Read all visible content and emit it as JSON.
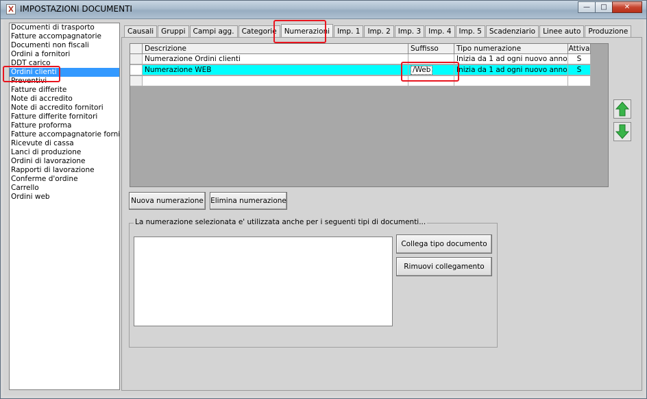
{
  "window": {
    "title": "IMPOSTAZIONI DOCUMENTI",
    "minimize_icon": "minimize-icon",
    "maximize_icon": "maximize-icon",
    "close_icon": "close-icon"
  },
  "doclist": {
    "items": [
      "Documenti di trasporto",
      "Fatture accompagnatorie",
      "Documenti non fiscali",
      "Ordini a fornitori",
      "DDT carico",
      "Ordini clienti",
      "Preventivi",
      "Fatture differite",
      "Note di accredito",
      "Note di accredito fornitori",
      "Fatture differite fornitori",
      "Fatture proforma",
      "Fatture accompagnatorie fornitori",
      "Ricevute di cassa",
      "Lanci di produzione",
      "Ordini di lavorazione",
      "Rapporti di lavorazione",
      "Conferme d'ordine",
      "Carrello",
      "Ordini web"
    ],
    "selected_index": 5
  },
  "tabs": [
    "Causali",
    "Gruppi",
    "Campi agg.",
    "Categorie",
    "Numerazioni",
    "Imp. 1",
    "Imp. 2",
    "Imp. 3",
    "Imp. 4",
    "Imp. 5",
    "Scadenziario",
    "Linee auto",
    "Produzione"
  ],
  "active_tab": "Numerazioni",
  "grid": {
    "headers": [
      "Descrizione",
      "Suffisso",
      "Tipo numerazione",
      "Attiva"
    ],
    "rows": [
      [
        "Numerazione Ordini clienti",
        "",
        "Inizia da 1 ad ogni nuovo anno",
        "S"
      ],
      [
        "Numerazione WEB",
        "/Web",
        "Inizia da 1 ad ogni nuovo anno",
        "S"
      ]
    ]
  },
  "buttons": {
    "new_numbering": "Nuova numerazione",
    "delete_numbering": "Elimina numerazione",
    "link_doc_type": "Collega tipo documento",
    "remove_link": "Rimuovi collegamento",
    "move_up_icon": "arrow-up-icon",
    "move_down_icon": "arrow-down-icon"
  },
  "linked_group": {
    "legend": "La numerazione selezionata e' utilizzata anche per i seguenti tipi di documenti...",
    "items": []
  },
  "colors": {
    "selection_blue": "#3399ff",
    "row_highlight_cyan": "#00ffff",
    "annotation_red": "#e8141e",
    "arrow_green": "#2fa52f"
  }
}
